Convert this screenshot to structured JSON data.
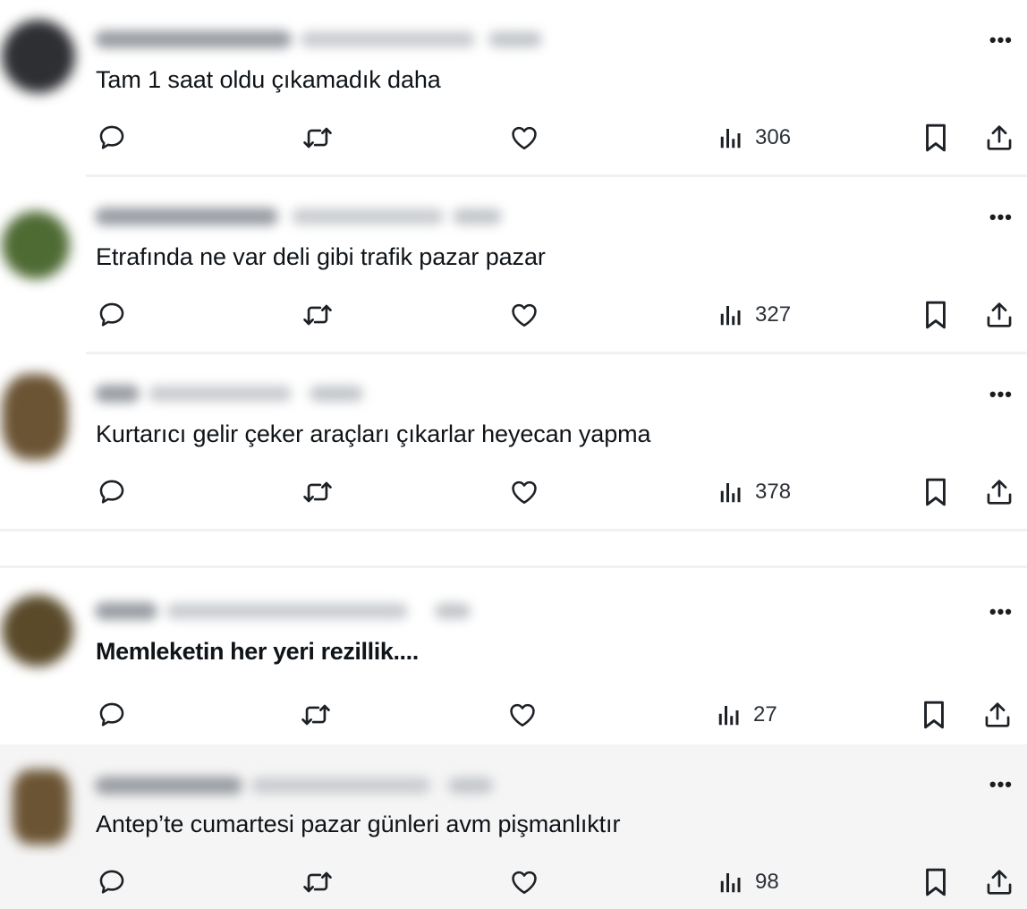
{
  "app": "X",
  "icons": {
    "reply": "speech-bubble-icon",
    "retweet": "repost-arrows-icon",
    "like": "heart-icon",
    "views": "bar-chart-icon",
    "bookmark": "bookmark-icon",
    "share": "share-upload-icon",
    "more": "more-dots-icon"
  },
  "more_label": "•••",
  "tweets": [
    {
      "text": "Tam 1 saat oldu çıkamadık daha",
      "views": "306",
      "avatar_color": "#2e2f33"
    },
    {
      "text": "Etrafında ne var deli gibi trafik pazar pazar",
      "views": "327",
      "avatar_color": "#4a4446"
    },
    {
      "text": "Kurtarıcı gelir çeker araçları çıkarlar heyecan yapma",
      "views": "378",
      "avatar_color": "#4f6b34"
    },
    {
      "text": "Memleketin her yeri rezillik....",
      "views": "27",
      "avatar_color": "#5a4a2a"
    },
    {
      "text": "Antep’te cumartesi pazar günleri avm pişmanlıktır",
      "views": "98",
      "avatar_color": "#6b5434"
    }
  ]
}
